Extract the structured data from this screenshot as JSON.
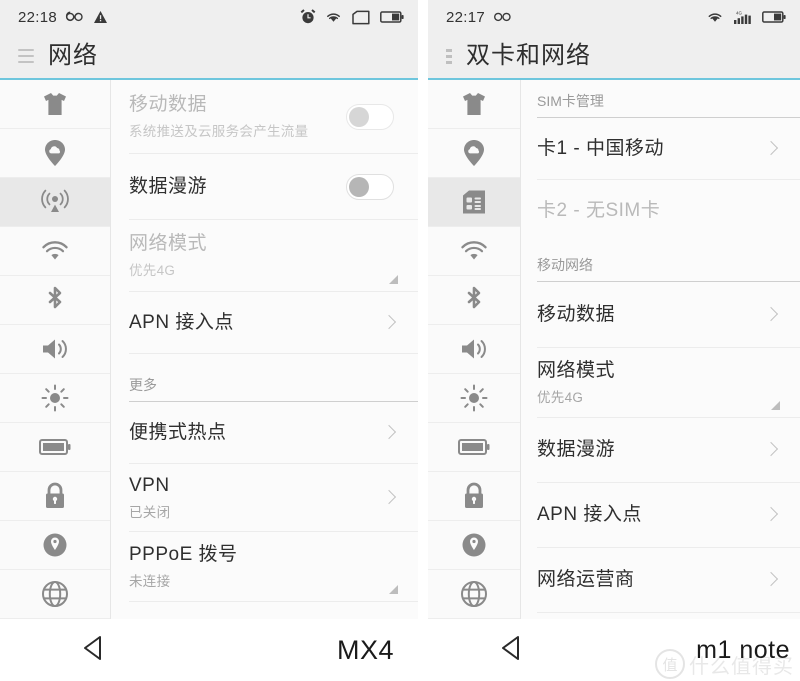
{
  "left_phone": {
    "model_label": "MX4",
    "statusbar": {
      "time": "22:18",
      "icons": [
        "infinity-icon",
        "warning-icon",
        "alarm-clock-icon",
        "wifi-icon",
        "sim-card-icon",
        "battery-icon"
      ]
    },
    "titlebar": {
      "title": "网络",
      "menu_icon": "hamburger-icon"
    },
    "sidebar": [
      {
        "icon": "tshirt-icon",
        "active": false
      },
      {
        "icon": "cloud-account-icon",
        "active": false
      },
      {
        "icon": "network-signal-icon",
        "active": true
      },
      {
        "icon": "wifi-icon",
        "active": false
      },
      {
        "icon": "bluetooth-icon",
        "active": false
      },
      {
        "icon": "volume-icon",
        "active": false
      },
      {
        "icon": "brightness-icon",
        "active": false
      },
      {
        "icon": "battery-icon",
        "active": false
      },
      {
        "icon": "lock-icon",
        "active": false
      },
      {
        "icon": "location-pin-icon",
        "active": false
      },
      {
        "icon": "globe-icon",
        "active": false
      }
    ],
    "rows": [
      {
        "title": "移动数据",
        "subtitle": "系统推送及云服务会产生流量",
        "accessory": "toggle-off-pale",
        "dim": true
      },
      {
        "title": "数据漫游",
        "subtitle": "",
        "accessory": "toggle-off",
        "dim": false
      },
      {
        "title": "网络模式",
        "subtitle": "优先4G",
        "accessory": "corner-triangle",
        "dim": true
      },
      {
        "title": "APN 接入点",
        "subtitle": "",
        "accessory": "chevron",
        "dim": false
      }
    ],
    "section_more": "更多",
    "rows_more": [
      {
        "title": "便携式热点",
        "subtitle": "",
        "accessory": "chevron",
        "dim": false
      },
      {
        "title": "VPN",
        "subtitle": "已关闭",
        "accessory": "chevron",
        "dim": false
      },
      {
        "title": "PPPoE 拨号",
        "subtitle": "未连接",
        "accessory": "corner-triangle",
        "dim": false
      }
    ]
  },
  "right_phone": {
    "model_label": "m1 note",
    "statusbar": {
      "time": "22:17",
      "icons": [
        "infinity-icon",
        "wifi-icon",
        "signal-4g-icon",
        "battery-icon"
      ]
    },
    "titlebar": {
      "title": "双卡和网络",
      "menu_icon": "hamburger-icon"
    },
    "sidebar": [
      {
        "icon": "tshirt-icon",
        "active": false
      },
      {
        "icon": "cloud-account-icon",
        "active": false
      },
      {
        "icon": "sim-card-icon",
        "active": true
      },
      {
        "icon": "wifi-icon",
        "active": false
      },
      {
        "icon": "bluetooth-icon",
        "active": false
      },
      {
        "icon": "volume-icon",
        "active": false
      },
      {
        "icon": "brightness-icon",
        "active": false
      },
      {
        "icon": "battery-icon",
        "active": false
      },
      {
        "icon": "lock-icon",
        "active": false
      },
      {
        "icon": "location-pin-icon",
        "active": false
      },
      {
        "icon": "globe-icon",
        "active": false
      }
    ],
    "section_sim": "SIM卡管理",
    "rows_sim": [
      {
        "title": "卡1 - 中国移动",
        "subtitle": "",
        "accessory": "chevron",
        "dim": false
      },
      {
        "title": "卡2 - 无SIM卡",
        "subtitle": "",
        "accessory": "none",
        "dim": true
      }
    ],
    "section_mobile": "移动网络",
    "rows_mobile": [
      {
        "title": "移动数据",
        "subtitle": "",
        "accessory": "chevron",
        "dim": false
      },
      {
        "title": "网络模式",
        "subtitle": "优先4G",
        "accessory": "corner-triangle",
        "dim": false
      },
      {
        "title": "数据漫游",
        "subtitle": "",
        "accessory": "chevron",
        "dim": false
      },
      {
        "title": "APN 接入点",
        "subtitle": "",
        "accessory": "chevron",
        "dim": false
      },
      {
        "title": "网络运营商",
        "subtitle": "",
        "accessory": "chevron",
        "dim": false
      }
    ]
  },
  "watermark": {
    "mark": "值",
    "text": "什么值得买"
  },
  "colors": {
    "accent_underline": "#6ec6dd",
    "statusbar_bg": "#efefef",
    "list_bg": "#fbfbfb",
    "title_text": "#2e2e2e",
    "row_title": "#2f2f2f",
    "row_subtitle": "#a6a6a6",
    "dim_text": "#b9b9b9",
    "icon_gray": "#8a8a8a",
    "divider": "#ececec"
  }
}
